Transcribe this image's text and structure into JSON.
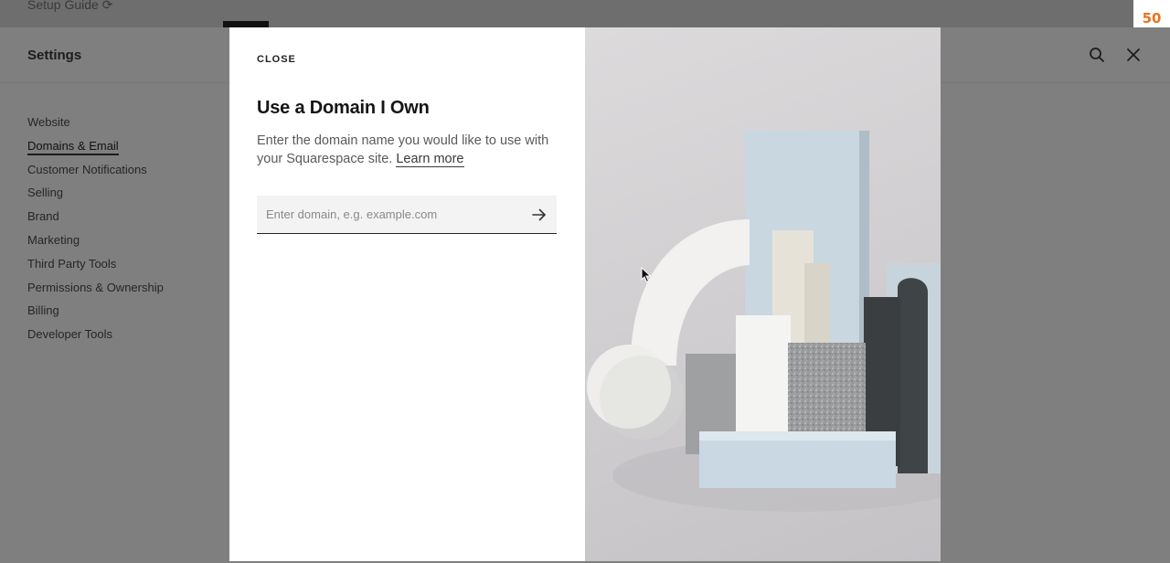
{
  "topbar": {
    "setup_guide": "Setup Guide",
    "ext_icon_text": "50"
  },
  "settings": {
    "title": "Settings",
    "nav_items": [
      {
        "label": "Website",
        "active": false
      },
      {
        "label": "Domains & Email",
        "active": true
      },
      {
        "label": "Customer Notifications",
        "active": false
      },
      {
        "label": "Selling",
        "active": false
      },
      {
        "label": "Brand",
        "active": false
      },
      {
        "label": "Marketing",
        "active": false
      },
      {
        "label": "Third Party Tools",
        "active": false
      },
      {
        "label": "Permissions & Ownership",
        "active": false
      },
      {
        "label": "Billing",
        "active": false
      },
      {
        "label": "Developer Tools",
        "active": false
      }
    ]
  },
  "modal": {
    "close_label": "CLOSE",
    "title": "Use a Domain I Own",
    "description": "Enter the domain name you would like to use with your Squarespace site.",
    "learn_more": "Learn more",
    "input_placeholder": "Enter domain, e.g. example.com",
    "input_value": ""
  },
  "icons": {
    "search": "search-icon",
    "close": "close-icon",
    "arrow": "arrow-right-icon"
  },
  "colors": {
    "overlay": "#808080",
    "modal_bg": "#ffffff",
    "text_primary": "#151515",
    "text_secondary": "#5a5a5a"
  }
}
